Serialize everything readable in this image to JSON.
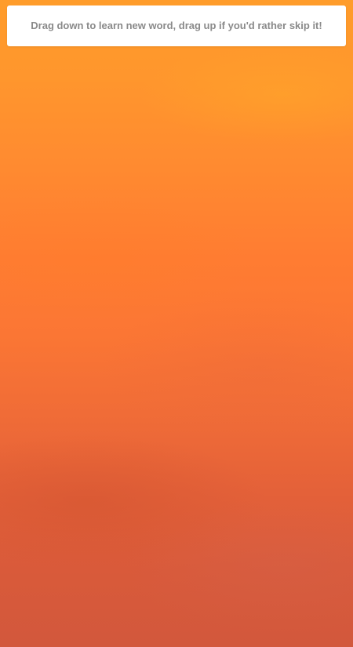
{
  "background": {
    "top_color": "#ff9c2a",
    "bottom_color": "#d2583c"
  },
  "banner": {
    "text": "Drag down to learn new word, drag up if you'd rather skip it!",
    "background_color": "#ffffff",
    "text_color": "#8a8a8a"
  }
}
